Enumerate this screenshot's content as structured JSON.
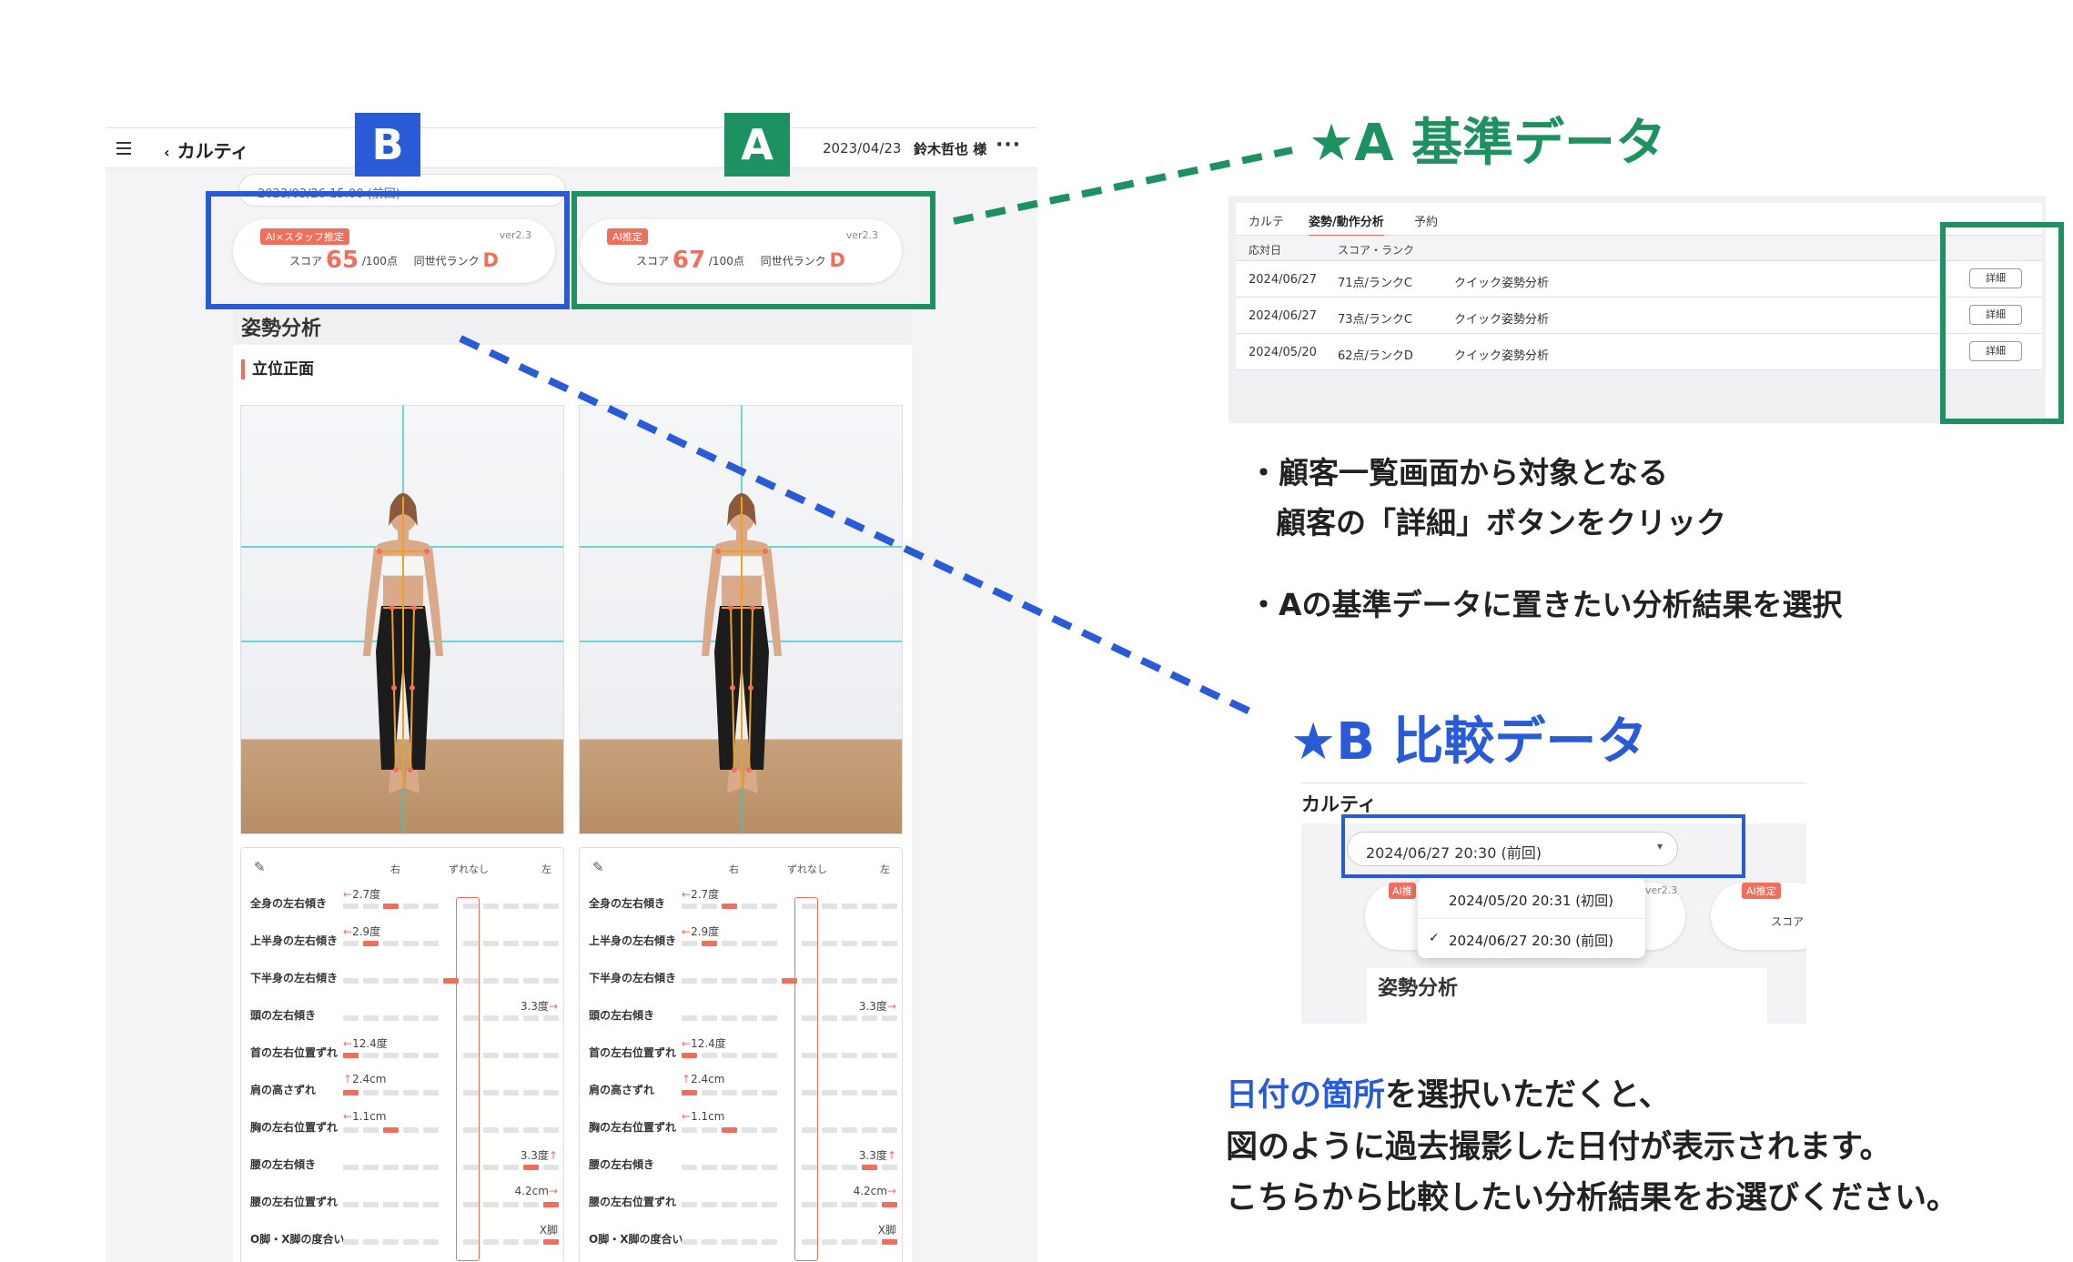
{
  "app": {
    "title": "カルティ",
    "date": "2023/04/23",
    "customer": "鈴木哲也 様",
    "more": "···",
    "date_selector": "2023/03/26 15:00 (前回)",
    "score_b": {
      "badge": "AI×スタッフ推定",
      "version": "ver2.3",
      "score_label": "スコア",
      "score": "65",
      "score_suffix": "/100点",
      "rank_label": "同世代ランク",
      "rank": "D"
    },
    "score_a": {
      "badge": "AI推定",
      "version": "ver2.3",
      "score_label": "スコア",
      "score": "67",
      "score_suffix": "/100点",
      "rank_label": "同世代ランク",
      "rank": "D"
    },
    "section_title": "姿勢分析",
    "subsection": "立位正面",
    "table_header": {
      "right": "右",
      "center": "ずれなし",
      "left": "左"
    },
    "rows": [
      {
        "label": "全身の左右傾き",
        "value": "2.7度",
        "arrow": "←",
        "side": "right",
        "pos": 2
      },
      {
        "label": "上半身の左右傾き",
        "value": "2.9度",
        "arrow": "←",
        "side": "right",
        "pos": 1
      },
      {
        "label": "下半身の左右傾き",
        "value": "",
        "arrow": "",
        "side": "center",
        "pos": 3
      },
      {
        "label": "頭の左右傾き",
        "value": "3.3度",
        "arrow": "→",
        "side": "left",
        "pos": 6
      },
      {
        "label": "首の左右位置ずれ",
        "value": "12.4度",
        "arrow": "←",
        "side": "right",
        "pos": 0
      },
      {
        "label": "肩の高さずれ",
        "value": "2.4cm",
        "arrow": "↑",
        "side": "right",
        "pos": 0
      },
      {
        "label": "胸の左右位置ずれ",
        "value": "1.1cm",
        "arrow": "←",
        "side": "right",
        "pos": 2
      },
      {
        "label": "腰の左右傾き",
        "value": "3.3度",
        "arrow": "↑",
        "side": "left",
        "pos": 4
      },
      {
        "label": "腰の左右位置ずれ",
        "value": "4.2cm",
        "arrow": "→",
        "side": "left",
        "pos": 5
      },
      {
        "label": "O脚・X脚の度合い",
        "value": "X脚",
        "arrow": "",
        "side": "left",
        "pos": 5
      }
    ]
  },
  "labels": {
    "b": "B",
    "a": "A"
  },
  "heading_a": "★A 基準データ",
  "heading_b": "★B 比較データ",
  "history": {
    "tabs": [
      "カルテ",
      "姿勢/動作分析",
      "予約"
    ],
    "columns": [
      "応対日",
      "スコア・ランク"
    ],
    "rows": [
      {
        "date": "2024/06/27",
        "score": "71点/ランクC",
        "type": "クイック姿勢分析",
        "button": "詳細"
      },
      {
        "date": "2024/06/27",
        "score": "73点/ランクC",
        "type": "クイック姿勢分析",
        "button": "詳細"
      },
      {
        "date": "2024/05/20",
        "score": "62点/ランクD",
        "type": "クイック姿勢分析",
        "button": "詳細"
      }
    ]
  },
  "bullets": [
    "・顧客一覧画面から対象となる",
    "顧客の「詳細」ボタンをクリック",
    "・Aの基準データに置きたい分析結果を選択"
  ],
  "dropdown": {
    "title": "カルティ",
    "selected": "2024/06/27 20:30 (前回)",
    "caret": "▾",
    "options": [
      "2024/05/20 20:31 (初回)",
      "2024/06/27 20:30 (前回)"
    ],
    "check": "✓",
    "badge_left": "AI推",
    "version": "ver2.3",
    "badge_right": "AI推定",
    "score_label": "スコア",
    "section": "姿勢分析"
  },
  "paragraph": {
    "highlight": "日付の箇所",
    "line1_rest": "を選択いただくと、",
    "line2": "図のように過去撮影した日付が表示されます。",
    "line3": "こちらから比較したい分析結果をお選びください。"
  },
  "colors": {
    "blue": "#2a5bd7",
    "green": "#1e9160",
    "coral": "#ef6f5c",
    "cyan": "#37c8c2"
  }
}
